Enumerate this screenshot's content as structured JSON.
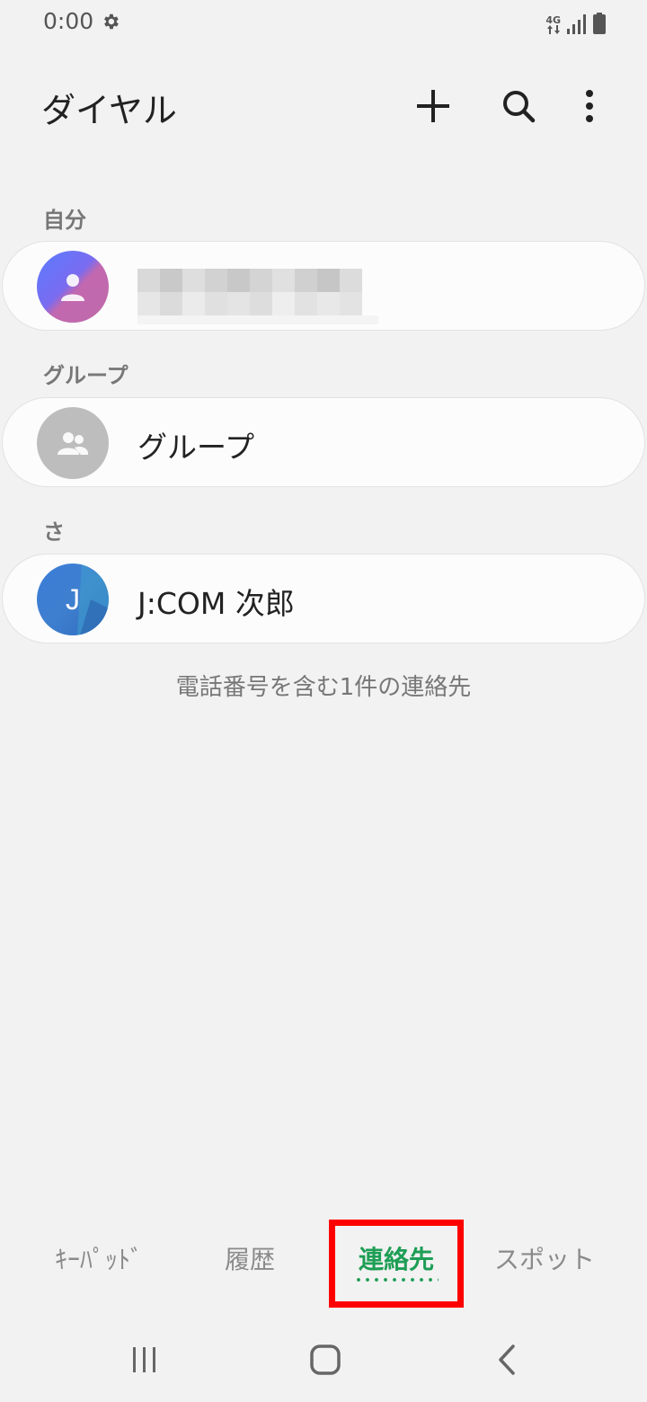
{
  "status_bar": {
    "time": "0:00",
    "network": "4G",
    "icons": [
      "gear-icon",
      "data-arrows-icon",
      "signal-icon",
      "battery-icon"
    ]
  },
  "app_bar": {
    "title": "ダイヤル",
    "actions": [
      "plus-icon",
      "search-icon",
      "more-vert-icon"
    ]
  },
  "sections": {
    "me": {
      "header": "自分"
    },
    "groups": {
      "header": "グループ",
      "item_label": "グループ"
    },
    "sa": {
      "header": "さ",
      "contact_name": "J:COM 次郎",
      "avatar_letter": "J"
    }
  },
  "contact_count": "電話番号を含む1件の連絡先",
  "tabs": [
    {
      "label": "ｷｰﾊﾟｯﾄﾞ",
      "active": false
    },
    {
      "label": "履歴",
      "active": false
    },
    {
      "label": "連絡先",
      "active": true
    },
    {
      "label": "スポット",
      "active": false
    }
  ],
  "colors": {
    "background": "#f2f2f2",
    "active_tab": "#1e9e55",
    "highlight": "#ff0000"
  },
  "nav_bar": [
    "recents-icon",
    "home-icon",
    "back-icon"
  ]
}
